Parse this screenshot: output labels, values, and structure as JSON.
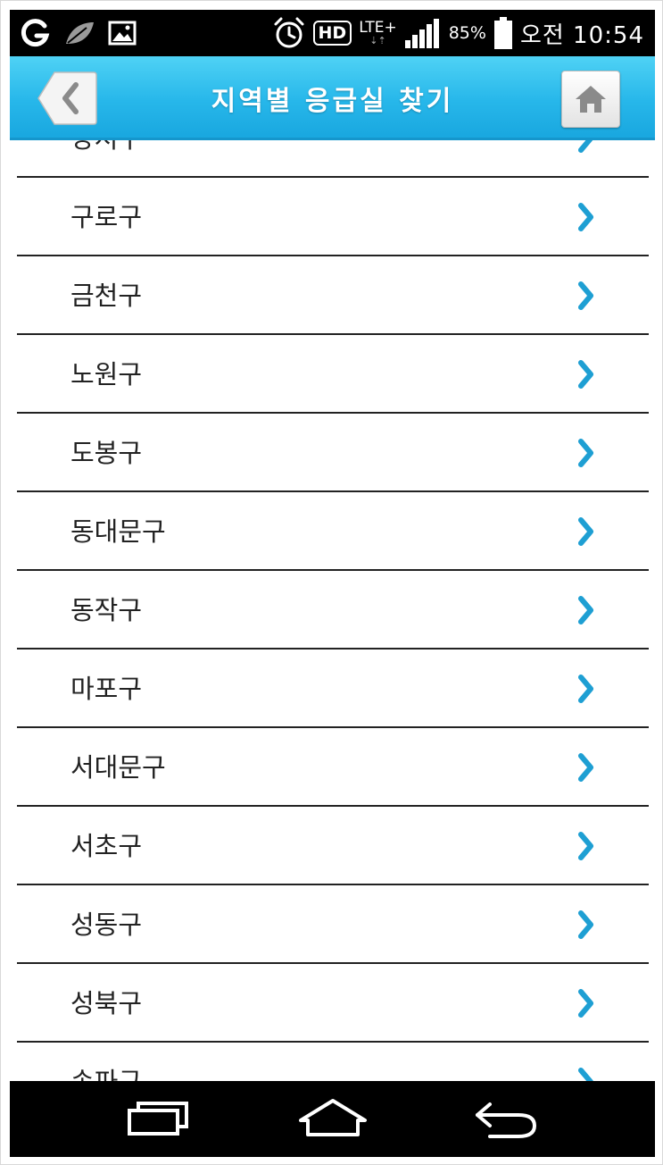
{
  "status_bar": {
    "time": "오전 10:54",
    "battery": "85%",
    "hd": "HD",
    "lte": "LTE+",
    "icons": [
      "carrier-g-icon",
      "leaf-icon",
      "gallery-icon",
      "alarm-icon",
      "hd-icon",
      "lte-icon",
      "signal-icon",
      "battery-icon"
    ]
  },
  "header": {
    "title": "지역별 응급실 찾기",
    "back_icon": "chevron-left-icon",
    "home_icon": "home-icon"
  },
  "list": {
    "partial_top": "강서구",
    "items": [
      "구로구",
      "금천구",
      "노원구",
      "도봉구",
      "동대문구",
      "동작구",
      "마포구",
      "서대문구",
      "서초구",
      "성동구",
      "성북구"
    ],
    "partial_bottom": "송파구"
  },
  "colors": {
    "header_blue": "#27b7ea",
    "chevron_blue": "#1e9fd3",
    "divider": "#222222"
  },
  "nav_bar": {
    "icons": [
      "recent-apps-icon",
      "home-icon",
      "back-icon"
    ]
  }
}
